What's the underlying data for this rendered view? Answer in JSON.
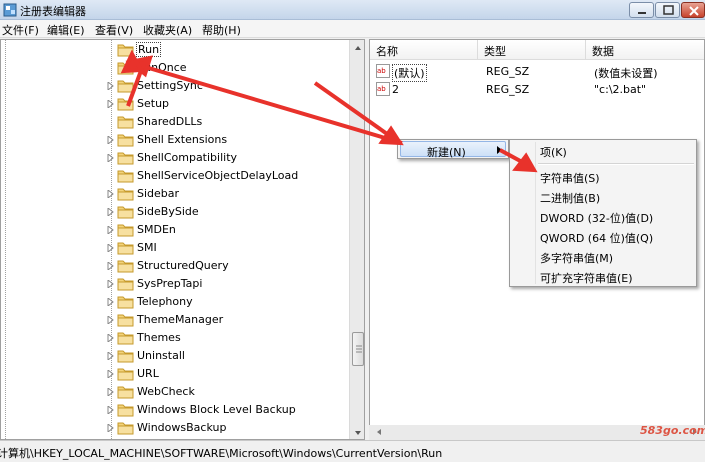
{
  "window": {
    "title": "注册表编辑器",
    "icon": "regedit-icon"
  },
  "menu": [
    "文件(F)",
    "编辑(E)",
    "查看(V)",
    "收藏夹(A)",
    "帮助(H)"
  ],
  "tree": {
    "items": [
      {
        "label": "Run",
        "expandable": false,
        "selected": true
      },
      {
        "label": "RunOnce",
        "expandable": false
      },
      {
        "label": "SettingSync",
        "expandable": true
      },
      {
        "label": "Setup",
        "expandable": true
      },
      {
        "label": "SharedDLLs",
        "expandable": false
      },
      {
        "label": "Shell Extensions",
        "expandable": true
      },
      {
        "label": "ShellCompatibility",
        "expandable": true
      },
      {
        "label": "ShellServiceObjectDelayLoad",
        "expandable": false
      },
      {
        "label": "Sidebar",
        "expandable": true
      },
      {
        "label": "SideBySide",
        "expandable": true
      },
      {
        "label": "SMDEn",
        "expandable": true
      },
      {
        "label": "SMI",
        "expandable": true
      },
      {
        "label": "StructuredQuery",
        "expandable": true
      },
      {
        "label": "SysPrepTapi",
        "expandable": true
      },
      {
        "label": "Telephony",
        "expandable": true
      },
      {
        "label": "ThemeManager",
        "expandable": true
      },
      {
        "label": "Themes",
        "expandable": true
      },
      {
        "label": "Uninstall",
        "expandable": true
      },
      {
        "label": "URL",
        "expandable": true
      },
      {
        "label": "WebCheck",
        "expandable": true
      },
      {
        "label": "Windows Block Level Backup",
        "expandable": true
      },
      {
        "label": "WindowsBackup",
        "expandable": true
      }
    ]
  },
  "list": {
    "columns": [
      "名称",
      "类型",
      "数据"
    ],
    "rows": [
      {
        "name": "(默认)",
        "type": "REG_SZ",
        "data": "(数值未设置)",
        "icon": "string-value-icon"
      },
      {
        "name": "2",
        "type": "REG_SZ",
        "data": "\"c:\\2.bat\"",
        "icon": "string-value-icon"
      }
    ]
  },
  "context_menu": {
    "new_label": "新建(N)"
  },
  "submenu": {
    "items": [
      "项(K)",
      "字符串值(S)",
      "二进制值(B)",
      "DWORD (32-位)值(D)",
      "QWORD (64 位)值(Q)",
      "多字符串值(M)",
      "可扩充字符串值(E)"
    ]
  },
  "status": {
    "path": "计算机\\HKEY_LOCAL_MACHINE\\SOFTWARE\\Microsoft\\Windows\\CurrentVersion\\Run"
  },
  "watermark": "583go.com",
  "annotation_color": "#e8322b"
}
